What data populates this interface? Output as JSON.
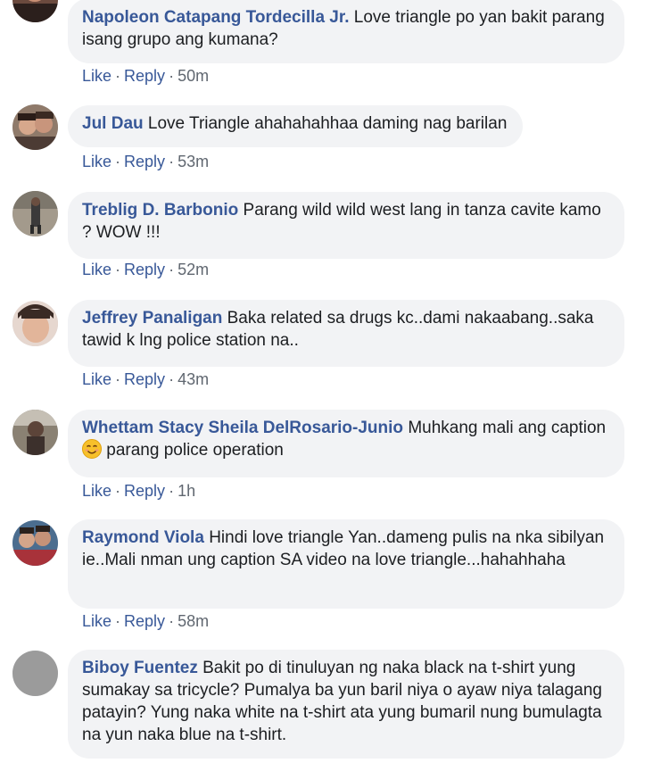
{
  "comments": [
    {
      "author": "Napoleon Catapang Tordecilla Jr.",
      "text": "Love triangle po yan bakit parang isang grupo ang kumana?",
      "like": "Like",
      "reply": "Reply",
      "time": "50m"
    },
    {
      "author": "Jul Dau",
      "text": "Love Triangle ahahahahhaa daming nag barilan",
      "like": "Like",
      "reply": "Reply",
      "time": "53m"
    },
    {
      "author": "Treblig D. Barbonio",
      "text": "Parang wild wild west lang in tanza cavite kamo ? WOW !!!",
      "like": "Like",
      "reply": "Reply",
      "time": "52m"
    },
    {
      "author": "Jeffrey Panaligan",
      "text": "Baka related sa drugs kc..dami nakaabang..saka tawid k lng police station na..",
      "like": "Like",
      "reply": "Reply",
      "time": "43m"
    },
    {
      "author": "Whettam Stacy Sheila DelRosario-Junio",
      "text_before_emoji": "Muhkang mali ang caption",
      "emoji": "smiling-face-emoji",
      "text_after_emoji": "parang police operation",
      "like": "Like",
      "reply": "Reply",
      "time": "1h"
    },
    {
      "author": "Raymond Viola",
      "text": "Hindi love triangle Yan..dameng pulis na nka sibilyan ie..Mali nman ung caption SA video na love triangle...hahahhaha",
      "like": "Like",
      "reply": "Reply",
      "time": "58m"
    },
    {
      "author": "Biboy Fuentez",
      "text": "Bakit po di tinuluyan ng naka black na t-shirt yung sumakay sa tricycle? Pumalya ba yun baril niya o ayaw niya talagang patayin? Yung naka white na t-shirt ata yung bumaril nung bumulagta na yun naka blue na t-shirt."
    }
  ],
  "colors": {
    "author": "#385898",
    "bubble": "#f2f3f5",
    "meta": "#606770"
  }
}
